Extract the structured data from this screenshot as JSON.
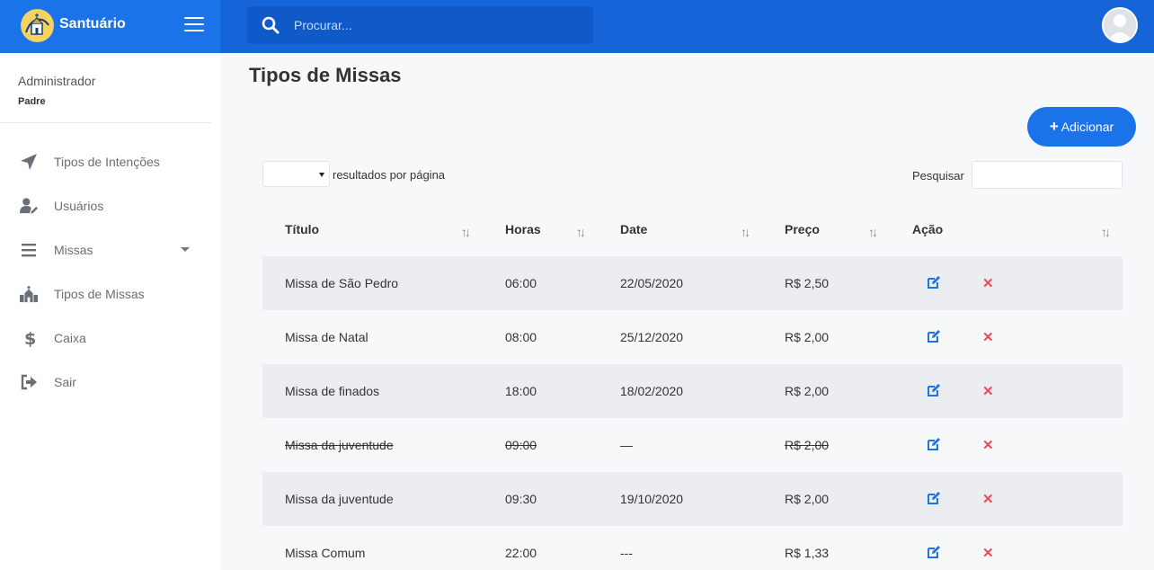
{
  "app": {
    "brand_name": "Santuário"
  },
  "search": {
    "placeholder": "Procurar..."
  },
  "user": {
    "role": "Administrador",
    "name": "Padre"
  },
  "sidebar": {
    "items": [
      {
        "label": "Tipos de Intenções",
        "icon": "paper-plane-icon"
      },
      {
        "label": "Usuários",
        "icon": "user-edit-icon"
      },
      {
        "label": "Missas",
        "icon": "bars-icon",
        "has_submenu": true
      },
      {
        "label": "Tipos de Missas",
        "icon": "church-icon"
      },
      {
        "label": "Caixa",
        "icon": "dollar-icon"
      },
      {
        "label": "Sair",
        "icon": "sign-out-icon"
      }
    ]
  },
  "main": {
    "title": "Tipos de Missas",
    "add_label": "Adicionar",
    "per_page_label": "resultados por página",
    "per_page_value": "",
    "filter_label": "Pesquisar",
    "filter_value": "",
    "table": {
      "columns": [
        "Título",
        "Horas",
        "Date",
        "Preço",
        "Ação"
      ],
      "rows": [
        {
          "titulo": "Missa de São Pedro",
          "horas": "06:00",
          "date": "22/05/2020",
          "preco": "R$ 2,50",
          "strike": false
        },
        {
          "titulo": "Missa de Natal",
          "horas": "08:00",
          "date": "25/12/2020",
          "preco": "R$ 2,00",
          "strike": false
        },
        {
          "titulo": "Missa de finados",
          "horas": "18:00",
          "date": "18/02/2020",
          "preco": "R$ 2,00",
          "strike": false
        },
        {
          "titulo": "Missa da juventude",
          "horas": "09:00",
          "date": "—",
          "preco": "R$ 2,00",
          "strike": true
        },
        {
          "titulo": "Missa da juventude",
          "horas": "09:30",
          "date": "19/10/2020",
          "preco": "R$ 2,00",
          "strike": false
        },
        {
          "titulo": "Missa Comum",
          "horas": "22:00",
          "date": "---",
          "preco": "R$ 1,33",
          "strike": false
        }
      ]
    }
  },
  "colors": {
    "primary": "#1a73e8",
    "topbar": "#1565d8",
    "edit_icon": "#1a73e8",
    "delete_icon": "#e84c5c",
    "row_odd": "#ebedf0"
  }
}
